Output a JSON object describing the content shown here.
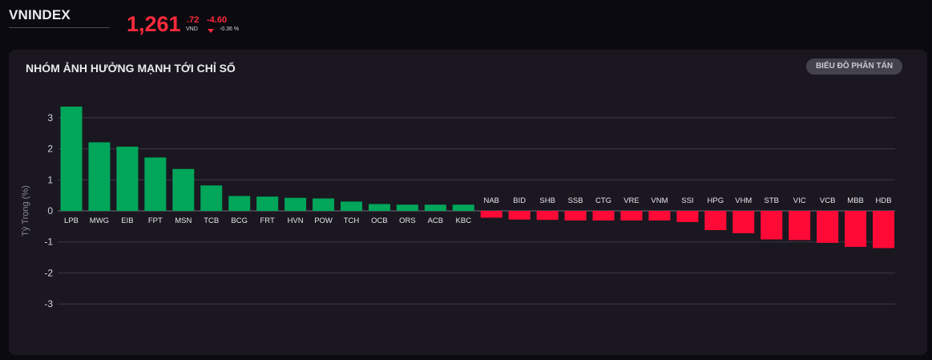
{
  "header": {
    "index_name": "VNINDEX",
    "price_main": "1,261",
    "price_decimal": ".72",
    "price_unit": "VND",
    "change": "-4.60",
    "change_pct": "-0.36 %",
    "change_icon": "down-triangle-icon",
    "down_color": "#ff2a3c"
  },
  "panel": {
    "title": "NHÓM ẢNH HƯỞNG MẠNH TỚI CHỈ SỐ",
    "scatter_button": "BIỂU ĐỒ PHÂN TÁN"
  },
  "chart_data": {
    "type": "bar",
    "ylabel": "Tỷ Trọng (%)",
    "ylim": [
      -3,
      3
    ],
    "yticks": [
      3,
      2,
      1,
      0,
      -1,
      -2,
      -3
    ],
    "grid": true,
    "positive_color": "#00a65a",
    "negative_color": "#ff0a36",
    "categories": [
      "LPB",
      "MWG",
      "EIB",
      "FPT",
      "MSN",
      "TCB",
      "BCG",
      "FRT",
      "HVN",
      "POW",
      "TCH",
      "OCB",
      "ORS",
      "ACB",
      "KBC",
      "NAB",
      "BID",
      "SHB",
      "SSB",
      "CTG",
      "VRE",
      "VNM",
      "SSI",
      "HPG",
      "VHM",
      "STB",
      "VIC",
      "VCB",
      "MBB",
      "HDB"
    ],
    "values": [
      3.36,
      2.21,
      2.07,
      1.72,
      1.35,
      0.82,
      0.48,
      0.46,
      0.42,
      0.4,
      0.3,
      0.22,
      0.2,
      0.2,
      0.2,
      -0.22,
      -0.28,
      -0.29,
      -0.31,
      -0.31,
      -0.31,
      -0.31,
      -0.36,
      -0.62,
      -0.72,
      -0.92,
      -0.94,
      -1.03,
      -1.16,
      -1.2
    ]
  }
}
